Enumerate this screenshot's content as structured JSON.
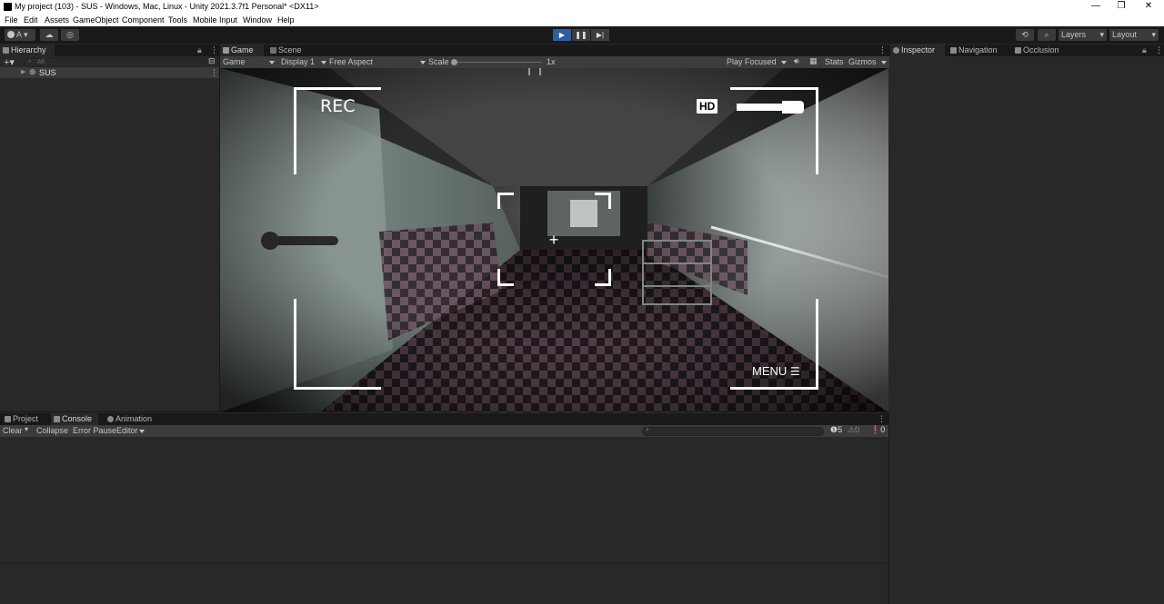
{
  "window": {
    "title": "My project (103) - SUS - Windows, Mac, Linux - Unity 2021.3.7f1 Personal* <DX11>",
    "controls": [
      "—",
      "❐",
      "✕"
    ]
  },
  "menu": [
    "File",
    "Edit",
    "Assets",
    "GameObject",
    "Component",
    "Tools",
    "Mobile Input",
    "Window",
    "Help"
  ],
  "toolbar": {
    "account_label": "A",
    "layers_label": "Layers",
    "layout_label": "Layout"
  },
  "hierarchy": {
    "tab_label": "Hierarchy",
    "search_placeholder": "All",
    "scene_name": "SUS"
  },
  "game_tabs": [
    "Game",
    "Scene"
  ],
  "game_bar": {
    "mode": "Game",
    "display": "Display 1",
    "aspect": "Free Aspect",
    "scale_label": "Scale",
    "scale_value": "1x",
    "play_focused": "Play Focused",
    "stats": "Stats",
    "gizmos": "Gizmos"
  },
  "hud": {
    "rec": "REC",
    "hd": "HD",
    "menu": "MENU"
  },
  "inspector_tabs": [
    "Inspector",
    "Navigation",
    "Occlusion"
  ],
  "bottom_tabs": [
    "Project",
    "Console",
    "Animation"
  ],
  "console_bar": {
    "clear": "Clear",
    "collapse": "Collapse",
    "error_pause": "Error Pause",
    "editor": "Editor",
    "log_count": "5",
    "warning_count": "0",
    "error_count": "0"
  }
}
